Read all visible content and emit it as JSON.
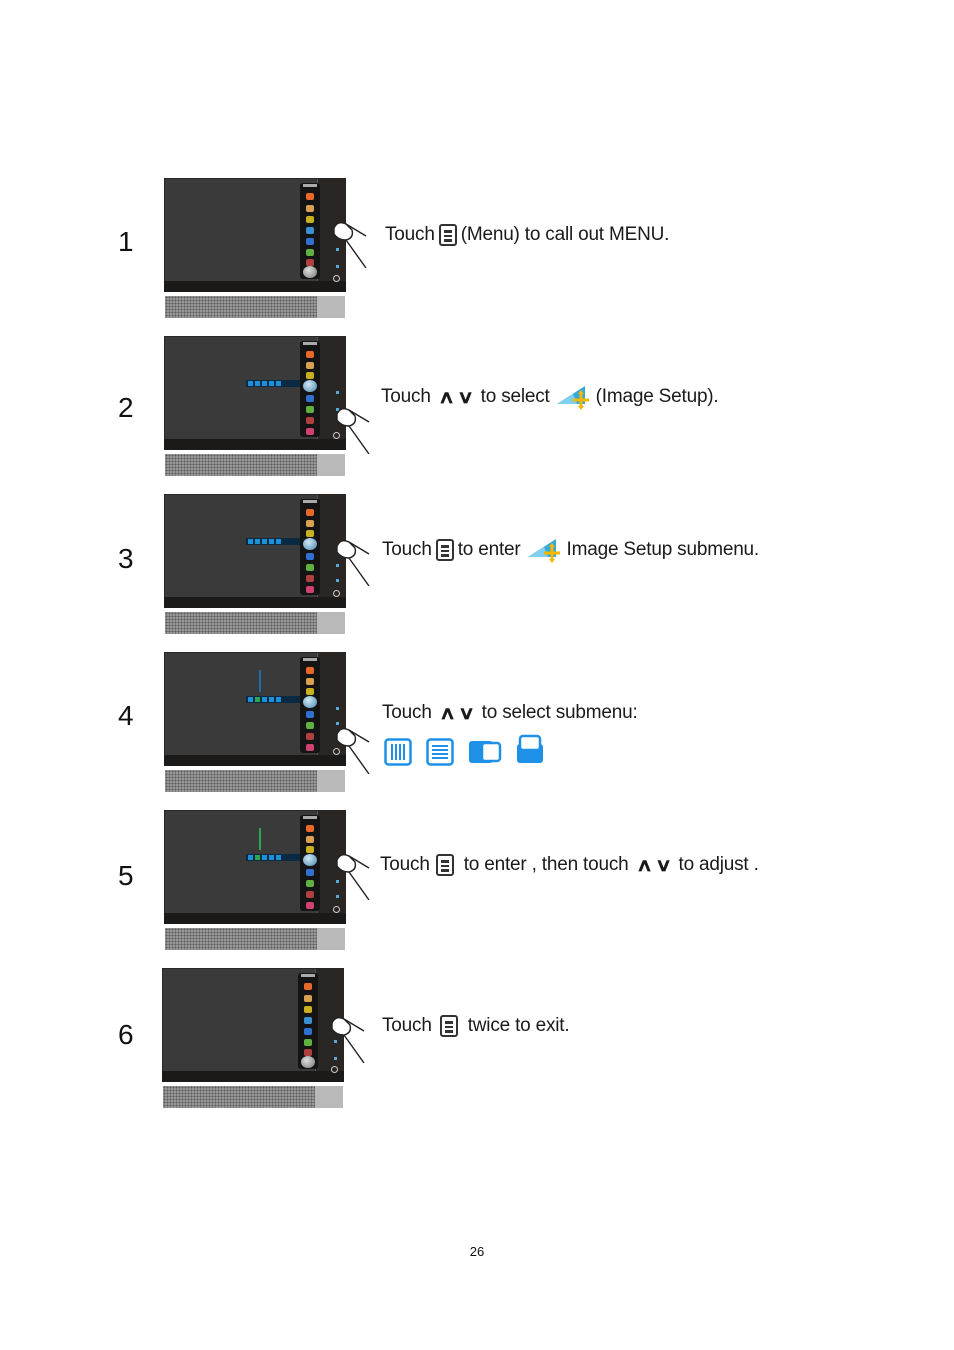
{
  "steps": [
    {
      "number": "1",
      "parts": [
        "Touch",
        "(Menu) to  call out MENU."
      ]
    },
    {
      "number": "2",
      "parts": [
        "Touch",
        "to select",
        "(Image Setup)."
      ]
    },
    {
      "number": "3",
      "parts": [
        "Touch",
        "to enter",
        "Image Setup   submenu."
      ]
    },
    {
      "number": "4",
      "parts": [
        "Touch",
        "to select submenu:"
      ]
    },
    {
      "number": "5",
      "parts": [
        "Touch",
        "to enter ,  then touch",
        "to  adjust ."
      ]
    },
    {
      "number": "6",
      "parts": [
        "Touch",
        "twice to exit."
      ]
    }
  ],
  "glyphs": {
    "up": "∧",
    "down": "∨"
  },
  "icons": {
    "menu": "menu-button-icon",
    "image_setup": "image-setup-icon",
    "submenu": [
      "horizontal-position-icon",
      "vertical-position-icon",
      "clock-icon",
      "focus-icon"
    ]
  },
  "colors": {
    "accent_blue": "#1e90e8",
    "monitor_bezel": "#2a2624"
  },
  "page_number": "26"
}
